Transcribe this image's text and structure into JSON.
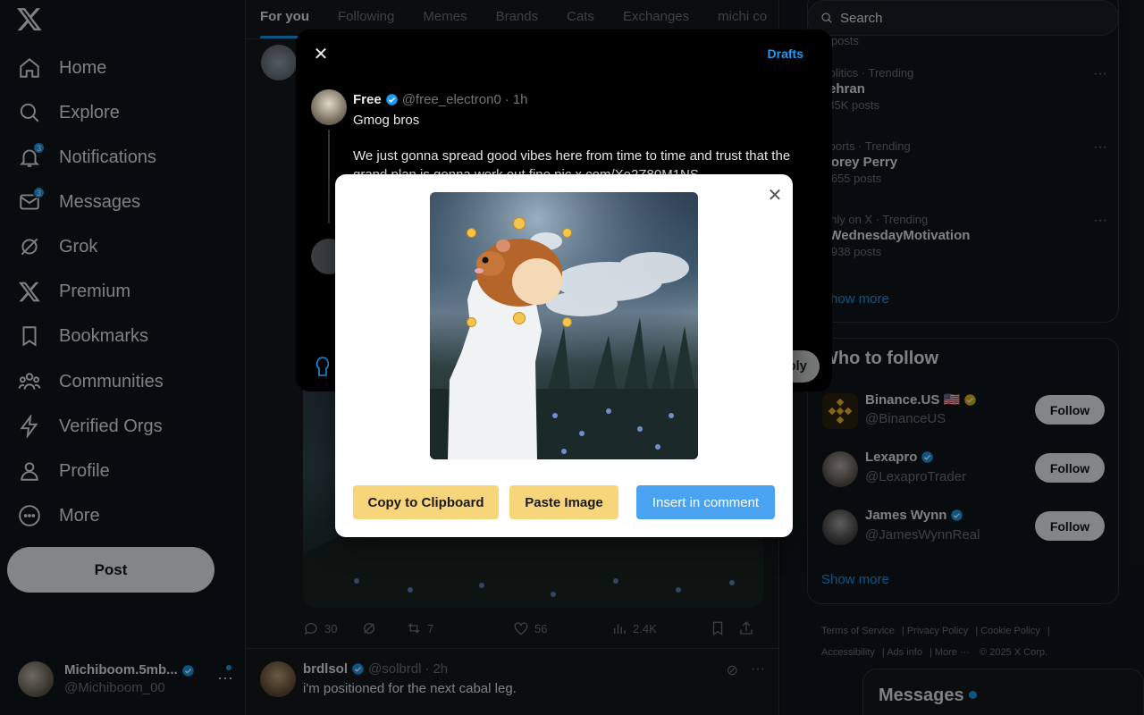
{
  "nav": {
    "items": [
      {
        "label": "Home",
        "icon": "home-icon"
      },
      {
        "label": "Explore",
        "icon": "search-icon"
      },
      {
        "label": "Notifications",
        "icon": "bell-icon",
        "badge": "3"
      },
      {
        "label": "Messages",
        "icon": "envelope-icon",
        "badge": "3"
      },
      {
        "label": "Grok",
        "icon": "grok-icon"
      },
      {
        "label": "Premium",
        "icon": "x-icon"
      },
      {
        "label": "Bookmarks",
        "icon": "bookmark-icon"
      },
      {
        "label": "Communities",
        "icon": "people-icon"
      },
      {
        "label": "Verified Orgs",
        "icon": "lightning-icon"
      },
      {
        "label": "Profile",
        "icon": "person-icon"
      },
      {
        "label": "More",
        "icon": "more-circle-icon"
      }
    ],
    "post_label": "Post",
    "account": {
      "name": "Michiboom.5mb...",
      "handle": "@Michiboom_00"
    }
  },
  "tabs": [
    "For you",
    "Following",
    "Memes",
    "Brands",
    "Cats",
    "Exchanges",
    "michi co"
  ],
  "feed": {
    "actions": {
      "replies": "30",
      "reposts": "7",
      "likes": "56",
      "views": "2.4K"
    },
    "tweet2": {
      "name": "brdlsol",
      "handle": "@solbrdl",
      "time": "2h",
      "text": "i'm positioned for the next cabal leg."
    }
  },
  "composer": {
    "drafts_label": "Drafts",
    "author": "Free",
    "handle": "@free_electron0",
    "time": "1h",
    "greeting": "Gmog bros",
    "body": "We just gonna spread good vibes here from time to time and trust that the grand plan is gonna work out fine pic.x.com/Xe2Z80M1NS",
    "reply_label": "Reply"
  },
  "dialog": {
    "copy_label": "Copy to Clipboard",
    "paste_label": "Paste Image",
    "insert_label": "Insert in comment"
  },
  "search": {
    "placeholder": "Search"
  },
  "trends": [
    {
      "category": "",
      "name": "",
      "count": "...posts"
    },
    {
      "category": "Politics · Trending",
      "name": "Tehran",
      "count": "135K posts"
    },
    {
      "category": "Sports · Trending",
      "name": "Corey Perry",
      "count": "1,655 posts"
    },
    {
      "category": "Only on X · Trending",
      "name": "#WednesdayMotivation",
      "count": "4,938 posts"
    }
  ],
  "trends_show_more": "Show more",
  "who_to_follow": {
    "title": "Who to follow",
    "accounts": [
      {
        "name": "Binance.US 🇺🇸",
        "handle": "@BinanceUS",
        "follow_label": "Follow"
      },
      {
        "name": "Lexapro",
        "handle": "@LexaproTrader",
        "follow_label": "Follow"
      },
      {
        "name": "James Wynn",
        "handle": "@JamesWynnReal",
        "follow_label": "Follow"
      }
    ],
    "show_more": "Show more"
  },
  "footer": {
    "links": [
      "Terms of Service",
      "Privacy Policy",
      "Cookie Policy",
      "Accessibility",
      "Ads info",
      "More ···"
    ],
    "copyright": "© 2025 X Corp."
  },
  "messages_drawer": {
    "title": "Messages"
  },
  "colors": {
    "accent": "#1d9bf0",
    "dialog_yellow": "#f7d57a",
    "dialog_blue": "#4aa3f0"
  }
}
